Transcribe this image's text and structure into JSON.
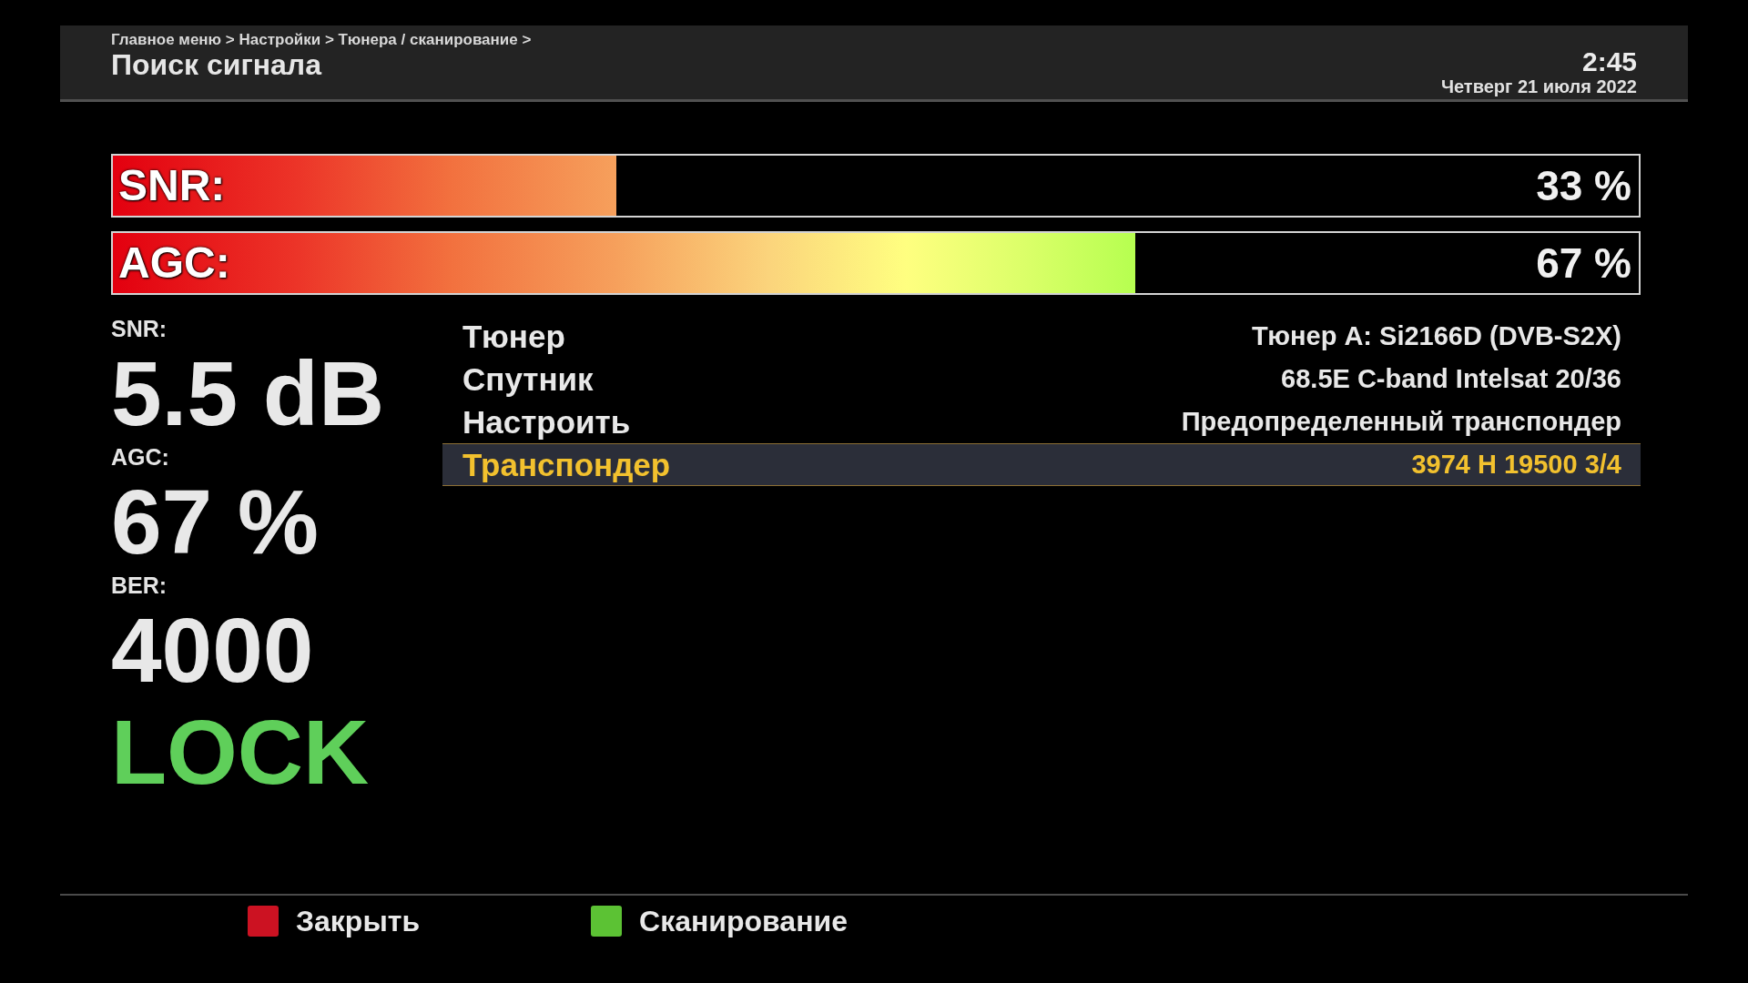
{
  "header": {
    "breadcrumb": "Главное меню > Настройки > Тюнера / сканирование >",
    "title": "Поиск сигнала",
    "time": "2:45",
    "date": "Четверг 21 июля 2022"
  },
  "meters": [
    {
      "label": "SNR:",
      "level": 0.33,
      "reading": "33 %"
    },
    {
      "label": "AGC:",
      "level": 0.67,
      "reading": "67 %"
    }
  ],
  "stats": [
    {
      "label": "SNR:",
      "value": "5.5 dB"
    },
    {
      "label": "AGC:",
      "value": "67 %"
    },
    {
      "label": "BER:",
      "value": "4000"
    }
  ],
  "lock_status": {
    "text": "LOCK",
    "locked": true
  },
  "settings": [
    {
      "label": "Тюнер",
      "value": "Тюнер A: Si2166D (DVB-S2X)",
      "selected": false
    },
    {
      "label": "Спутник",
      "value": "68.5E C-band Intelsat 20/36",
      "selected": false
    },
    {
      "label": "Настроить",
      "value": "Предопределенный транспондер",
      "selected": false
    },
    {
      "label": "Транспондер",
      "value": "3974 H 19500 3/4",
      "selected": true
    }
  ],
  "footer_buttons": [
    {
      "label": "Закрыть",
      "color": "#cc1222"
    },
    {
      "label": "Сканирование",
      "color": "#5cc234"
    }
  ]
}
